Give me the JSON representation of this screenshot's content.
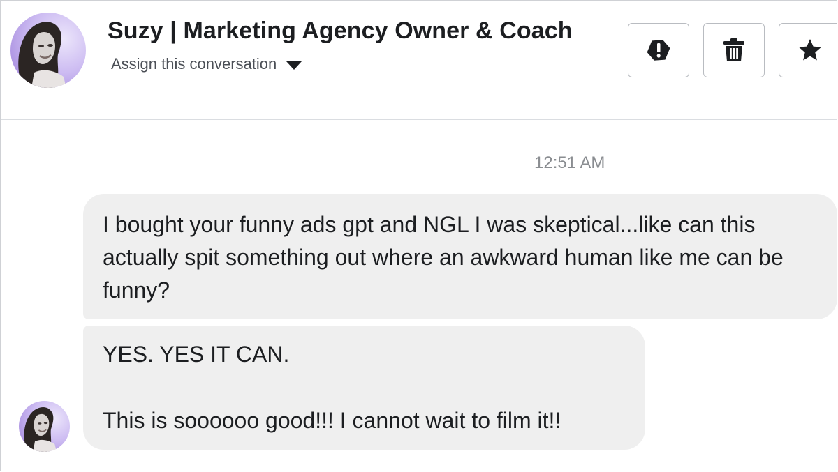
{
  "header": {
    "contact_name": "Suzy | Marketing Agency Owner & Coach",
    "assign_label": "Assign this conversation",
    "actions": [
      {
        "name": "spam",
        "icon": "exclamation-circle-icon"
      },
      {
        "name": "delete",
        "icon": "trash-icon"
      },
      {
        "name": "star",
        "icon": "star-icon"
      }
    ]
  },
  "conversation": {
    "timestamp": "12:51 AM",
    "messages": [
      {
        "text": "I bought your funny ads gpt and NGL I was skeptical...like can this actually spit something out where an awkward human like me can be funny?"
      },
      {
        "line1": "YES. YES IT CAN.",
        "line2": "This is soooooo good!!! I cannot wait to film it!!"
      }
    ]
  },
  "colors": {
    "bubble_bg": "#efefef",
    "timestamp": "#8a8d91",
    "divider": "#dadde1",
    "avatar_accent": "#c9b8f0"
  }
}
